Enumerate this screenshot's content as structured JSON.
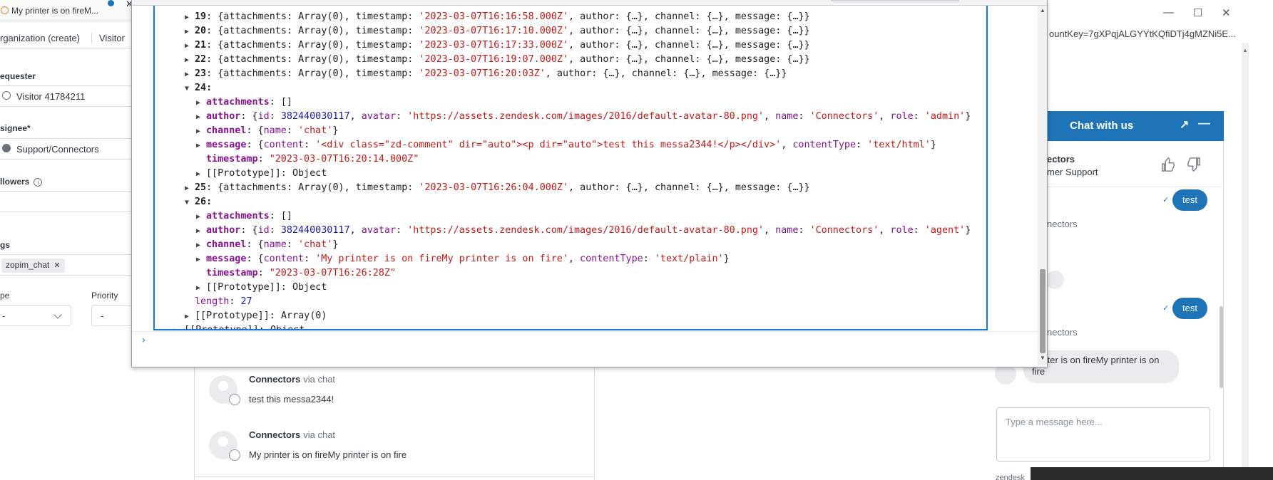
{
  "browser_tab": {
    "title": "My printer is on fireM..."
  },
  "left_panel": {
    "crumb_org": "rganization (create)",
    "crumb_visitor": "Visitor",
    "requester_label": "equester",
    "requester_value": "Visitor 41784211",
    "assignee_label": "signee*",
    "assignee_value": "Support/Connectors",
    "followers_label": "llowers",
    "tags_label": "gs",
    "tag": "zopim_chat",
    "type_label": "pe",
    "type_value": "-",
    "priority_label": "Priority",
    "priority_value": "-"
  },
  "console": {
    "lines": [
      {
        "kind": "collapsed",
        "index": "19",
        "timestamp": "'2023-03-07T16:16:58.000Z'"
      },
      {
        "kind": "collapsed",
        "index": "20",
        "timestamp": "'2023-03-07T16:17:10.000Z'"
      },
      {
        "kind": "collapsed",
        "index": "21",
        "timestamp": "'2023-03-07T16:17:33.000Z'"
      },
      {
        "kind": "collapsed",
        "index": "22",
        "timestamp": "'2023-03-07T16:19:07.000Z'"
      },
      {
        "kind": "collapsed",
        "index": "23",
        "timestamp": "'2023-03-07T16:20:03Z'"
      }
    ],
    "collapsed_prefix": "{attachments: Array(0), timestamp: ",
    "collapsed_suffix_a": ", author: {…}, channel: {…}, message: {…}}",
    "expanded_24": {
      "index": "24:",
      "attachments": "[]",
      "author_id": "382440030117",
      "author_avatar": "'https://assets.zendesk.com/images/2016/default-avatar-80.png'",
      "author_name": "'Connectors'",
      "author_role": "'admin'",
      "channel_name": "'chat'",
      "message_content": "'<div class=\"zd-comment\" dir=\"auto\"><p dir=\"auto\">test this messa2344!</p></div>'",
      "message_type": "'text/html'",
      "timestamp": "\"2023-03-07T16:20:14.000Z\""
    },
    "line_25": {
      "index": "25",
      "timestamp": "'2023-03-07T16:26:04.000Z'"
    },
    "expanded_26": {
      "index": "26:",
      "attachments": "[]",
      "author_id": "382440030117",
      "author_avatar": "'https://assets.zendesk.com/images/2016/default-avatar-80.png'",
      "author_name": "'Connectors'",
      "author_role": "'agent'",
      "channel_name": "'chat'",
      "message_content": "'My printer is on fireMy printer is on fire'",
      "message_type": "'text/plain'",
      "timestamp": "\"2023-03-07T16:26:28Z\""
    },
    "length_value": "27",
    "prototype_object": "Object",
    "prototype_array": "Array(0)"
  },
  "conversation": {
    "items": [
      {
        "author": "Connectors",
        "via": "via chat",
        "message": "test this messa2344!"
      },
      {
        "author": "Connectors",
        "via": "via chat",
        "message": "My printer is on fireMy printer is on fire"
      }
    ]
  },
  "right_window": {
    "url": "ountKey=7gXPqjALGYYtKQfiDTj4gMZNi5E..."
  },
  "chat_widget": {
    "title": "Chat with us",
    "agent_name": "ectors",
    "agent_role": "mer Support",
    "bubble_test_1": "test",
    "agent_label_1": "nectors",
    "bubble_test_2": "test",
    "agent_label_2": "nectors",
    "incoming_message": "printer is on fireMy printer is on fire",
    "input_placeholder": "Type a message here...",
    "footer": "zendesk"
  },
  "colors": {
    "accent": "#1f73b7",
    "console_string": "#c41a16",
    "console_number": "#1a1aa6",
    "console_property": "#881391"
  }
}
